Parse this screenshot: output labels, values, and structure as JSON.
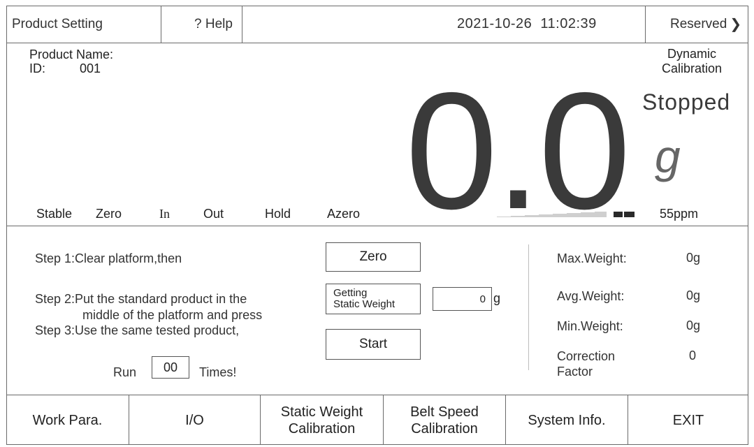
{
  "header": {
    "product_setting": "Product Setting",
    "help": "? Help",
    "datetime": "2021-10-26  11:02:39",
    "reserved": "Reserved"
  },
  "product": {
    "name_label": "Product Name:",
    "id_label": "ID:",
    "id_value": "001"
  },
  "display": {
    "mode_line1": "Dynamic",
    "mode_line2": "Calibration",
    "state": "Stopped",
    "value": "0.0",
    "unit": "g",
    "speed": "55ppm",
    "signal_level": 0.25
  },
  "status_flags": [
    "Stable",
    "Zero",
    "In",
    "Out",
    "Hold",
    "Azero"
  ],
  "steps": {
    "step1": "Step 1:Clear platform,then",
    "step2_line1": "Step 2:Put the standard product in the",
    "step2_line2": "middle of the platform and press",
    "step3": "Step 3:Use the same tested product,",
    "run_label": "Run",
    "run_value": "00",
    "times_label": "Times!"
  },
  "buttons": {
    "zero": "Zero",
    "getting_line1": "Getting",
    "getting_line2": "Static Weight",
    "static_weight_value": "0",
    "static_weight_unit": "g",
    "start": "Start"
  },
  "stats": {
    "max_label": "Max.Weight:",
    "max_value": "0g",
    "avg_label": "Avg.Weight:",
    "avg_value": "0g",
    "min_label": "Min.Weight:",
    "min_value": "0g",
    "corr_label_line1": "Correction",
    "corr_label_line2": "Factor",
    "corr_value": "0"
  },
  "nav": {
    "work_para": "Work Para.",
    "io": "I/O",
    "static_line1": "Static Weight",
    "static_line2": "Calibration",
    "belt_line1": "Belt Speed",
    "belt_line2": "Calibration",
    "system_info": "System Info.",
    "exit": "EXIT"
  }
}
